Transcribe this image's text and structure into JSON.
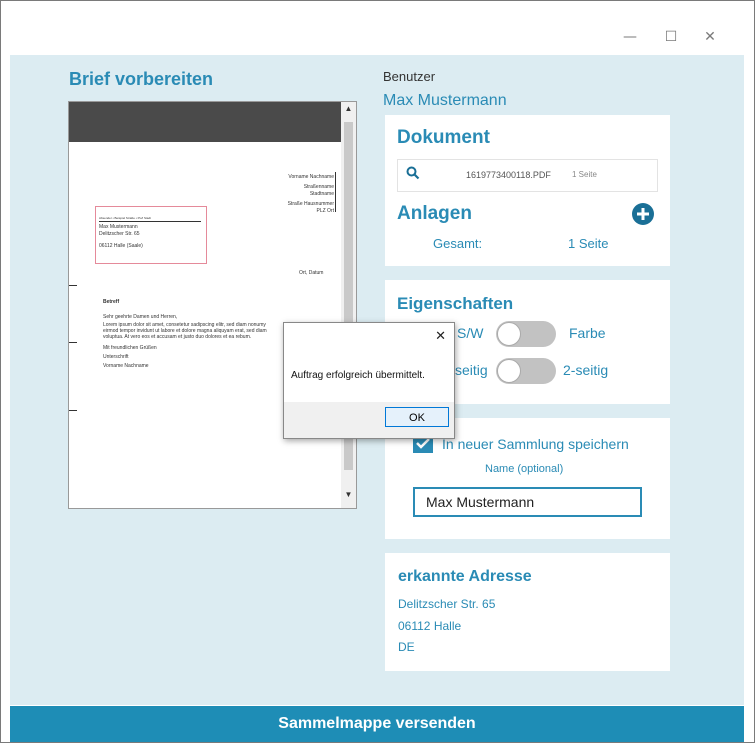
{
  "window": {
    "minimize_glyph": "—",
    "maximize_glyph": "☐",
    "close_glyph": "✕"
  },
  "left": {
    "title": "Brief vorbereiten"
  },
  "preview_doc": {
    "sender_lines": [
      "Vorname Nachname",
      "Straßenname",
      "Stadtname",
      "Straße Hausnummer",
      "PLZ Ort"
    ],
    "return_line": "Absender • Beispiel Straße • PLZ Stadt",
    "recipient_name": "Max Mustermann",
    "recipient_street": "Delitzscher Str. 65",
    "recipient_city": "06112 Halle (Saale)",
    "date": "Ort, Datum",
    "subject": "Betreff",
    "greeting": "Sehr geehrte Damen und Herren,",
    "body_1": "Lorem ipsum dolor sit amet, consetetur sadipscing elitr, sed diam nonumy",
    "body_2": "eirmod tempor invidunt ut labore et dolore magna aliquyam erat, sed diam",
    "body_3": "voluptua. At vero eos et accusam et justo duo dolores et ea rebum.",
    "closing": "Mit freundlichen Grüßen",
    "signature": "Unterschrift",
    "signer": "Vorname Nachname"
  },
  "dialog": {
    "message": "Auftrag erfolgreich übermittelt.",
    "ok_label": "OK",
    "close_glyph": "✕"
  },
  "user": {
    "label": "Benutzer",
    "name": "Max Mustermann"
  },
  "document_card": {
    "title": "Dokument",
    "file_name": "1619773400118.PDF",
    "pages": "1 Seite",
    "attachments_title": "Anlagen",
    "total_label": "Gesamt:",
    "total_value": "1 Seite"
  },
  "properties_card": {
    "title": "Eigenschaften",
    "color_left": "S/W",
    "color_right": "Farbe",
    "sides_left": "seitig",
    "sides_right": "2-seitig"
  },
  "collection_card": {
    "checkbox_label": "In neuer Sammlung speichern",
    "checked": true,
    "name_label": "Name (optional)",
    "name_value": "Max Mustermann"
  },
  "address_card": {
    "title": "erkannte Adresse",
    "street": "Delitzscher Str. 65",
    "city": "06112 Halle",
    "country": "DE"
  },
  "footer": {
    "send_label": "Sammelmappe versenden"
  },
  "colors": {
    "accent": "#2a8bb5",
    "background": "#dcecf2",
    "footer": "#1e8db6"
  }
}
